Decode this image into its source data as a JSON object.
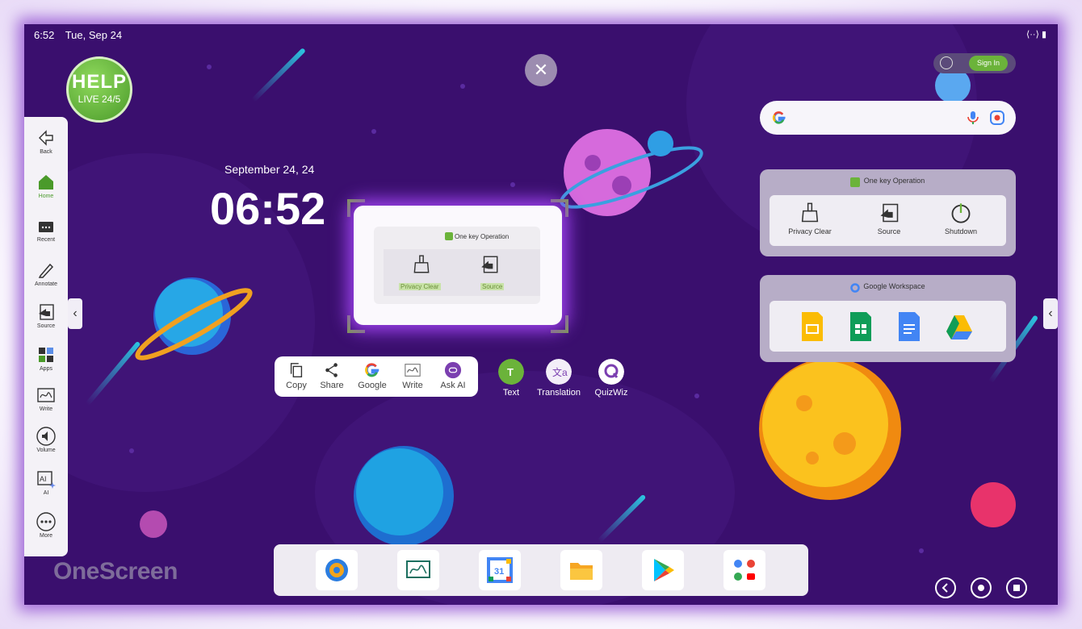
{
  "status_bar": {
    "time": "6:52",
    "date": "Tue, Sep 24"
  },
  "help_badge": {
    "line1": "HELP",
    "line2": "LIVE 24/5"
  },
  "sidebar": {
    "items": [
      {
        "label": "Back",
        "icon": "back-icon"
      },
      {
        "label": "Home",
        "icon": "home-icon",
        "active": true
      },
      {
        "label": "Recent",
        "icon": "recent-icon"
      },
      {
        "label": "Annotate",
        "icon": "annotate-icon"
      },
      {
        "label": "Source",
        "icon": "source-icon"
      },
      {
        "label": "Apps",
        "icon": "apps-icon"
      },
      {
        "label": "Write",
        "icon": "write-icon"
      },
      {
        "label": "Volume",
        "icon": "volume-icon"
      },
      {
        "label": "AI",
        "icon": "ai-icon"
      },
      {
        "label": "More",
        "icon": "more-icon"
      }
    ]
  },
  "clock": {
    "date": "September 24, 24",
    "time": "06:52"
  },
  "screenshot_preview": {
    "header": "One key Operation",
    "items": [
      "Privacy Clear",
      "Source"
    ]
  },
  "action_toolbar": {
    "buttons": [
      {
        "label": "Copy",
        "icon": "copy-icon"
      },
      {
        "label": "Share",
        "icon": "share-icon"
      },
      {
        "label": "Google",
        "icon": "google-icon"
      },
      {
        "label": "Write",
        "icon": "write-icon"
      },
      {
        "label": "Ask AI",
        "icon": "ask-ai-icon"
      }
    ],
    "extras": [
      {
        "label": "Text",
        "icon": "text-icon"
      },
      {
        "label": "Translation",
        "icon": "translation-icon"
      },
      {
        "label": "QuizWiz",
        "icon": "quizwiz-icon"
      }
    ]
  },
  "account": {
    "signin_label": "Sign In"
  },
  "one_key_panel": {
    "title": "One key Operation",
    "items": [
      {
        "label": "Privacy Clear",
        "icon": "brush-icon"
      },
      {
        "label": "Source",
        "icon": "source-icon"
      },
      {
        "label": "Shutdown",
        "icon": "power-icon"
      }
    ]
  },
  "workspace_panel": {
    "title": "Google Workspace",
    "apps": [
      "slides-icon",
      "sheets-icon",
      "docs-icon",
      "drive-icon"
    ]
  },
  "dock": {
    "apps": [
      "settings-icon",
      "whiteboard-icon",
      "calendar-icon",
      "files-icon",
      "play-store-icon",
      "google-apps-folder-icon"
    ],
    "calendar_day": "31"
  },
  "brand": {
    "logo_text": "OneScreen"
  },
  "colors": {
    "background": "#3a0f6e",
    "accent_green": "#6bb33a",
    "glow": "#9a40e8"
  }
}
